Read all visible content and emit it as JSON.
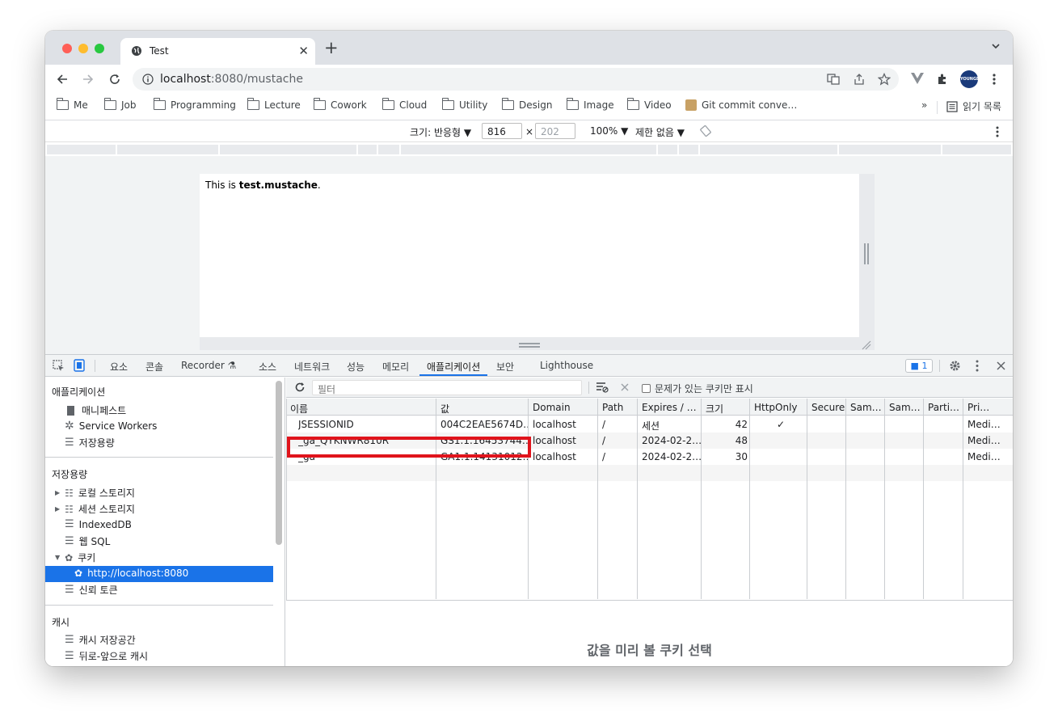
{
  "browser": {
    "tab_title": "Test",
    "url_host": "localhost",
    "url_rest": ":8080/mustache"
  },
  "bookmarks": {
    "items": [
      "Me",
      "Job",
      "Programming",
      "Lecture",
      "Cowork",
      "Cloud",
      "Utility",
      "Design",
      "Image",
      "Video"
    ],
    "special": "Git commit conve…",
    "more": "»",
    "reading_list": "읽기 목록"
  },
  "device_toolbar": {
    "size_label": "크기: 반응형 ▼",
    "width": "816",
    "times": "×",
    "height": "202",
    "zoom": "100% ▼",
    "throttle": "제한 없음 ▼"
  },
  "page": {
    "text_prefix": "This is ",
    "text_bold": "test.mustache",
    "text_suffix": "."
  },
  "devtools": {
    "tabs": [
      "요소",
      "콘솔",
      "Recorder",
      "소스",
      "네트워크",
      "성능",
      "메모리",
      "애플리케이션",
      "보안",
      "Lighthouse"
    ],
    "active_tab": "애플리케이션",
    "issues_count": "1",
    "sidebar": {
      "app_header": "애플리케이션",
      "manifest": "매니페스트",
      "service_workers": "Service Workers",
      "storage_item": "저장용량",
      "storage_header": "저장용량",
      "local_storage": "로컬 스토리지",
      "session_storage": "세션 스토리지",
      "indexeddb": "IndexedDB",
      "websql": "웹 SQL",
      "cookies": "쿠키",
      "cookie_origin": "http://localhost:8080",
      "trust_tokens": "신뢰 토큰",
      "cache_header": "캐시",
      "cache_storage": "캐시 저장공간",
      "bfcache": "뒤로-앞으로 캐시"
    },
    "filter_placeholder": "필터",
    "only_issues_label": "문제가 있는 쿠키만 표시",
    "columns": [
      "이름",
      "값",
      "Domain",
      "Path",
      "Expires / …",
      "크기",
      "HttpOnly",
      "Secure",
      "Sam…",
      "Sam…",
      "Parti…",
      "Pri…"
    ],
    "rows": [
      {
        "name": "JSESSIONID",
        "value": "004C2EAE5674D…",
        "domain": "localhost",
        "path": "/",
        "expires": "세션",
        "size": "42",
        "httponly": "✓",
        "priority": "Medi…"
      },
      {
        "name": "_ga_QYKNWR810R",
        "value": "GS1.1.16453744…",
        "domain": "localhost",
        "path": "/",
        "expires": "2024-02-2…",
        "size": "48",
        "httponly": "",
        "priority": "Medi…"
      },
      {
        "name": "_ga",
        "value": "GA1.1.14131012…",
        "domain": "localhost",
        "path": "/",
        "expires": "2024-02-2…",
        "size": "30",
        "httponly": "",
        "priority": "Medi…"
      }
    ],
    "preview_text": "값을 미리 볼 쿠키 선택"
  },
  "colors": {
    "accent": "#1a73e8",
    "highlight_box": "#e0141c"
  }
}
